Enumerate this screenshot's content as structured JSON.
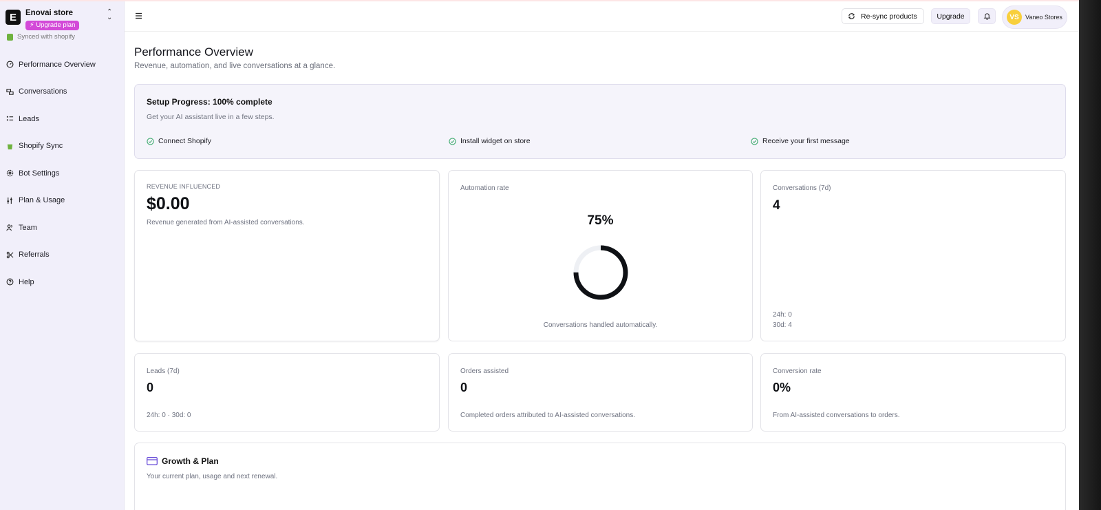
{
  "brand": {
    "name": "Enovai store",
    "upgrade_pill": "Upgrade plan",
    "synced": "Synced with shopify"
  },
  "sidebar": {
    "items": [
      {
        "label": "Performance Overview",
        "icon": "gauge-icon"
      },
      {
        "label": "Conversations",
        "icon": "chat-icon"
      },
      {
        "label": "Leads",
        "icon": "list-icon"
      },
      {
        "label": "Shopify Sync",
        "icon": "shopify-icon"
      },
      {
        "label": "Bot Settings",
        "icon": "gear-icon"
      },
      {
        "label": "Plan & Usage",
        "icon": "sliders-icon"
      },
      {
        "label": "Team",
        "icon": "users-icon"
      },
      {
        "label": "Referrals",
        "icon": "share-icon"
      },
      {
        "label": "Help",
        "icon": "help-icon"
      }
    ]
  },
  "topbar": {
    "resync_label": "Re-sync products",
    "upgrade_label": "Upgrade",
    "user_initials": "VS",
    "user_name": "Vaneo Stores"
  },
  "page": {
    "title": "Performance Overview",
    "subtitle": "Revenue, automation, and live conversations at a glance."
  },
  "setup": {
    "title": "Setup Progress: 100% complete",
    "subtitle": "Get your AI assistant live in a few steps.",
    "steps": [
      "Connect Shopify",
      "Install widget on store",
      "Receive your first message"
    ]
  },
  "cards": {
    "revenue": {
      "label": "REVENUE INFLUENCED",
      "value": "$0.00",
      "note": "Revenue generated from AI-assisted conversations."
    },
    "automation": {
      "label": "Automation rate",
      "value": "75%",
      "rate": 0.75,
      "note": "Conversations handled automatically."
    },
    "conversations": {
      "label": "Conversations (7d)",
      "value": "4",
      "h24": "24h: 0",
      "d30": "30d: 4"
    },
    "leads": {
      "label": "Leads (7d)",
      "value": "0",
      "note": "24h: 0 · 30d: 0"
    },
    "orders": {
      "label": "Orders assisted",
      "value": "0",
      "note": "Completed orders attributed to AI-assisted conversations."
    },
    "conversion": {
      "label": "Conversion rate",
      "value": "0%",
      "note": "From AI-assisted conversations to orders."
    },
    "growth": {
      "title": "Growth & Plan",
      "subtitle": "Your current plan, usage and next renewal."
    }
  },
  "colors": {
    "sidebar_bg": "#f1effa",
    "accent_pill": "#d349d8",
    "avatar": "#f8cf3c",
    "check": "#3aa96b",
    "growth_icon": "#6a4ed9"
  }
}
